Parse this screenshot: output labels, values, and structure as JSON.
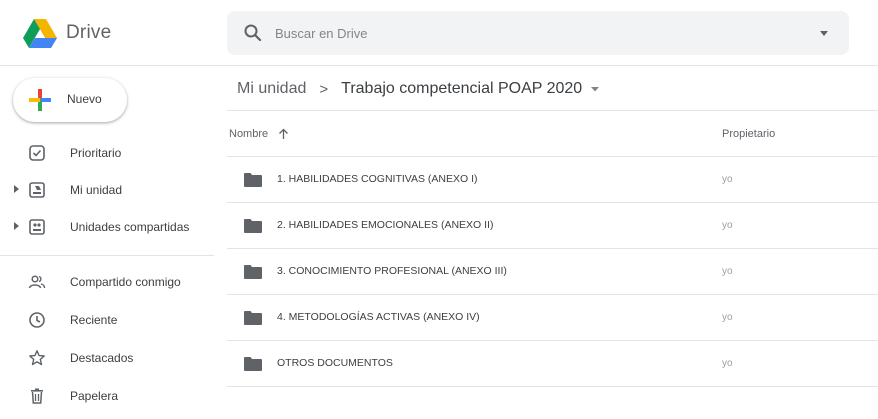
{
  "app": {
    "product_name": "Drive",
    "logo_icon": "google-drive-logo",
    "colors": {
      "drive_green": "#0f9d58",
      "drive_yellow": "#f4b400",
      "drive_blue": "#4285f4",
      "plus_red": "#ea4335"
    }
  },
  "search": {
    "placeholder": "Buscar en Drive",
    "icon": "search-icon",
    "options_icon": "caret-down-icon"
  },
  "sidebar": {
    "new_button_label": "Nuevo",
    "items": [
      {
        "label": "Prioritario",
        "icon": "priority-check-icon",
        "expandable": false
      },
      {
        "label": "Mi unidad",
        "icon": "my-drive-icon",
        "expandable": true
      },
      {
        "label": "Unidades compartidas",
        "icon": "shared-drives-icon",
        "expandable": true
      },
      {
        "label": "Compartido conmigo",
        "icon": "people-icon",
        "expandable": false
      },
      {
        "label": "Reciente",
        "icon": "clock-icon",
        "expandable": false
      },
      {
        "label": "Destacados",
        "icon": "star-icon",
        "expandable": false
      },
      {
        "label": "Papelera",
        "icon": "trash-icon",
        "expandable": false
      }
    ]
  },
  "breadcrumb": {
    "root": "Mi unidad",
    "separator": ">",
    "current": "Trabajo competencial POAP 2020"
  },
  "table": {
    "columns": {
      "name": "Nombre",
      "owner": "Propietario"
    },
    "sort": "ascending",
    "rows": [
      {
        "name": "1. HABILIDADES COGNITIVAS (ANEXO I)",
        "owner": "yo",
        "type": "folder"
      },
      {
        "name": "2. HABILIDADES EMOCIONALES (ANEXO II)",
        "owner": "yo",
        "type": "folder"
      },
      {
        "name": "3. CONOCIMIENTO PROFESIONAL (ANEXO III)",
        "owner": "yo",
        "type": "folder"
      },
      {
        "name": "4. METODOLOGÍAS ACTIVAS (ANEXO IV)",
        "owner": "yo",
        "type": "folder"
      },
      {
        "name": "OTROS DOCUMENTOS",
        "owner": "yo",
        "type": "folder"
      }
    ]
  }
}
